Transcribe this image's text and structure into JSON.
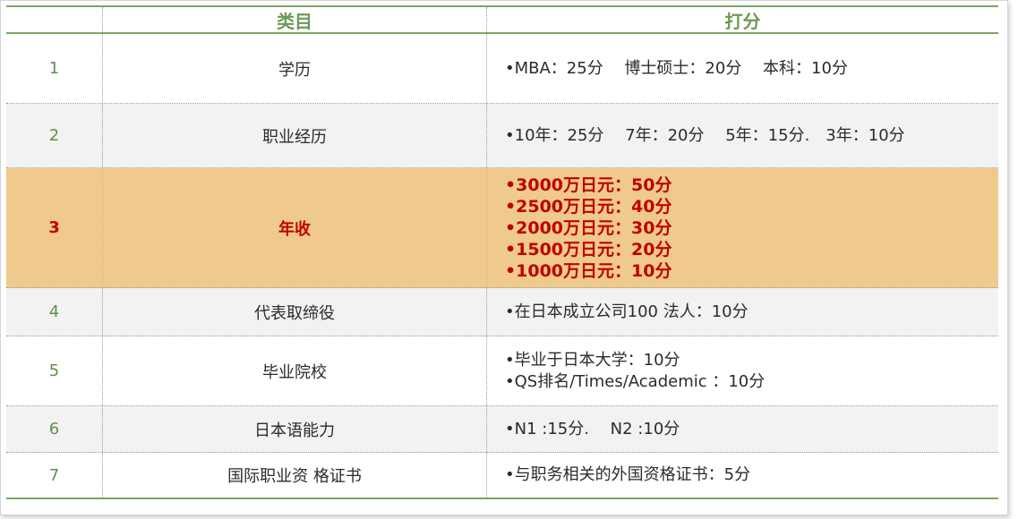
{
  "table": {
    "header": {
      "category": "类目",
      "score": "打分"
    },
    "rows": [
      {
        "no": "1",
        "category": "学历",
        "scores": [
          "•MBA：25分　 博士硕士：20分　 本科：10分"
        ]
      },
      {
        "no": "2",
        "category": "职业经历",
        "scores": [
          "•10年：25分　 7年：20分　 5年：15分.　3年：10分"
        ]
      },
      {
        "no": "3",
        "category": "年收",
        "scores": [
          "•3000万日元：50分",
          "•2500万日元：40分",
          "•2000万日元：30分",
          "•1500万日元：20分",
          "•1000万日元：10分"
        ]
      },
      {
        "no": "4",
        "category": "代表取缔役",
        "scores": [
          "•在日本成立公司100 法人：10分"
        ]
      },
      {
        "no": "5",
        "category": "毕业院校",
        "scores": [
          "•毕业于日本大学：10分",
          "•QS排名/Times/Academic ：10分"
        ]
      },
      {
        "no": "6",
        "category": "日本语能力",
        "scores": [
          "•N1 :15分.　 N2 :10分"
        ]
      },
      {
        "no": "7",
        "category": "国际职业资 格证书",
        "scores": [
          "•与职务相关的外国资格证书：5分"
        ]
      }
    ]
  },
  "colors": {
    "accent_green": "#79a766",
    "highlight_bg": "#f0ca8d",
    "highlight_text": "#c00000",
    "alt_row_bg": "#f2f2f2"
  }
}
